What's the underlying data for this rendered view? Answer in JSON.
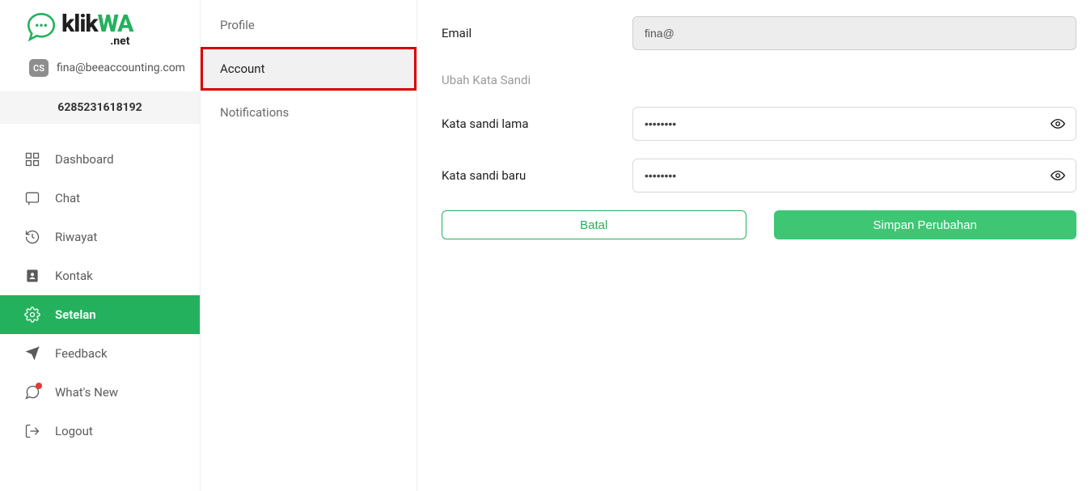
{
  "brand": {
    "text_pre": "klik",
    "text_accent": "WA",
    "suffix": ".net"
  },
  "user": {
    "badge": "CS",
    "email": "fina@beeaccounting.com"
  },
  "phone": "6285231618192",
  "nav": {
    "dashboard": "Dashboard",
    "chat": "Chat",
    "riwayat": "Riwayat",
    "kontak": "Kontak",
    "setelan": "Setelan",
    "feedback": "Feedback",
    "whatsnew": "What's New",
    "logout": "Logout"
  },
  "subnav": {
    "profile": "Profile",
    "account": "Account",
    "notifications": "Notifications"
  },
  "form": {
    "email_label": "Email",
    "email_value": "fina@",
    "section_label": "Ubah Kata Sandi",
    "old_pw_label": "Kata sandi lama",
    "old_pw_value": "••••••••",
    "new_pw_label": "Kata sandi baru",
    "new_pw_value": "••••••••",
    "cancel": "Batal",
    "save": "Simpan Perubahan"
  }
}
